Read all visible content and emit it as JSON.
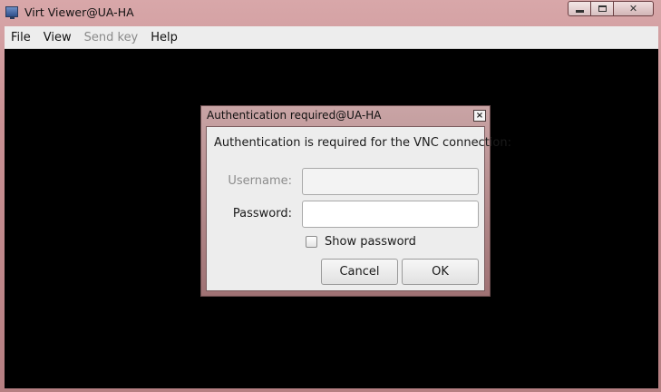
{
  "window": {
    "title": "Virt Viewer@UA-HA"
  },
  "menubar": {
    "items": [
      {
        "label": "File",
        "enabled": true
      },
      {
        "label": "View",
        "enabled": true
      },
      {
        "label": "Send key",
        "enabled": false
      },
      {
        "label": "Help",
        "enabled": true
      }
    ]
  },
  "dialog": {
    "title": "Authentication required@UA-HA",
    "message": "Authentication is required for the VNC connection:",
    "username_label": "Username:",
    "username_value": "",
    "password_label": "Password:",
    "password_value": "",
    "show_password_label": "Show password",
    "show_password_checked": false,
    "cancel_label": "Cancel",
    "ok_label": "OK"
  },
  "icons": {
    "app": "virt-viewer-monitor-icon",
    "minimize": "minimize-icon",
    "maximize": "maximize-icon",
    "close": "close-icon",
    "dialog_close": "close-icon"
  },
  "colors": {
    "viewer_background": "#000000",
    "dialog_background": "#ededed"
  }
}
